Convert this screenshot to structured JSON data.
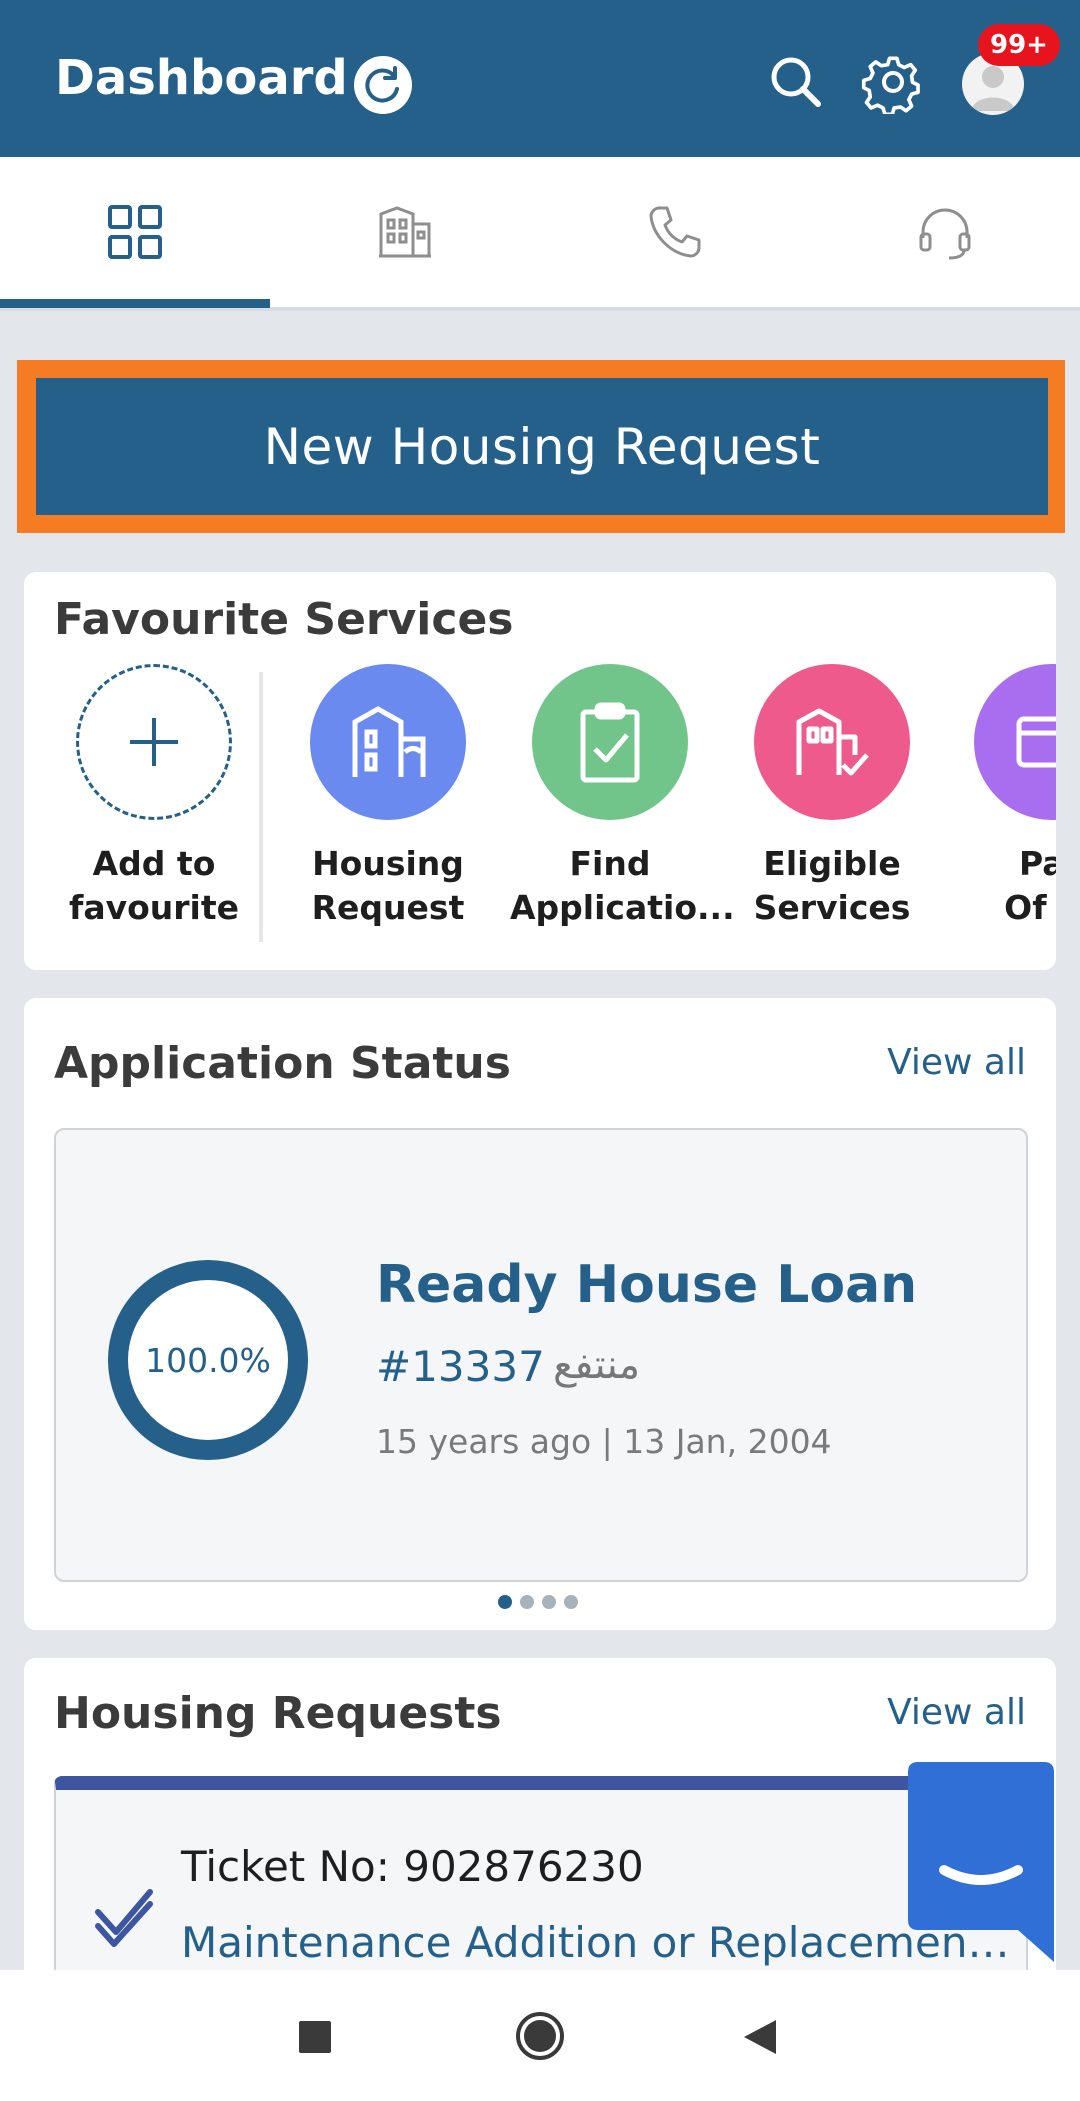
{
  "header": {
    "title": "Dashboard",
    "notification_badge": "99+",
    "icons": [
      "refresh-icon",
      "search-icon",
      "gear-icon",
      "avatar-icon"
    ],
    "color": "#246089"
  },
  "tabs": [
    {
      "icon": "grid-icon",
      "active": true
    },
    {
      "icon": "building-icon",
      "active": false
    },
    {
      "icon": "phone-icon",
      "active": false
    },
    {
      "icon": "headset-icon",
      "active": false
    }
  ],
  "cta": {
    "label": "New Housing Request",
    "highlight_color": "#f57c23"
  },
  "favourites": {
    "title": "Favourite Services",
    "add_label_1": "Add to",
    "add_label_2": "favourite",
    "items": [
      {
        "line1": "Housing",
        "line2": "Request",
        "color": "#6b8af0",
        "icon": "building-icon"
      },
      {
        "line1": "Find",
        "line2": "Applicatio...",
        "color": "#72c58a",
        "icon": "clipboard-check-icon"
      },
      {
        "line1": "Eligible",
        "line2": "Services",
        "color": "#ee5a8c",
        "icon": "building-check-icon"
      },
      {
        "line1": "Pay",
        "line2": "Of Ar",
        "color": "#a96ef0",
        "icon": "card-icon"
      }
    ]
  },
  "application_status": {
    "title": "Application Status",
    "view_all": "View all",
    "progress_text": "100.0%",
    "progress_value": 1.0,
    "loan_title": "Ready House Loan",
    "loan_number": "#13337",
    "loan_status_ar": "منتفع",
    "loan_date": "15 years ago | 13 Jan, 2004",
    "page_count": 4,
    "active_page": 0
  },
  "housing_requests": {
    "title": "Housing Requests",
    "view_all": "View all",
    "ticket": "Ticket No: 902876230",
    "description": "Maintenance Addition or Replacement L..."
  }
}
